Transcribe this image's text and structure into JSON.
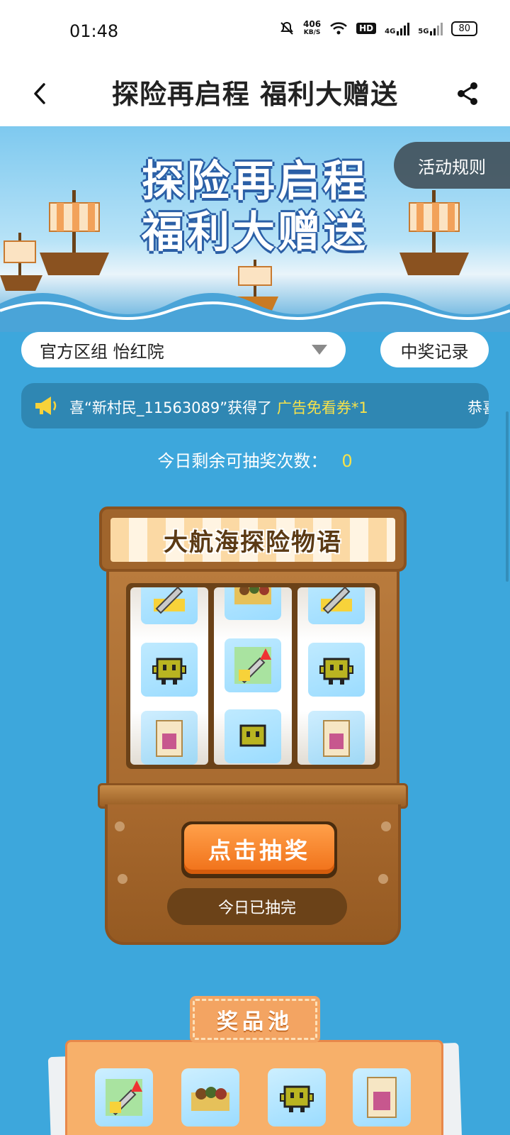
{
  "status_bar": {
    "time": "01:48",
    "net_speed_value": "406",
    "net_speed_unit": "KB/S",
    "hd_label": "HD",
    "net_4g": "4G",
    "net_5g": "5G",
    "battery": "80"
  },
  "nav": {
    "title": "探险再启程 福利大赠送"
  },
  "banner": {
    "title_line1": "探险再启程",
    "title_line2": "福利大赠送",
    "rules_label": "活动规则"
  },
  "server": {
    "selected": "官方区组 怡红院"
  },
  "record_label": "中奖记录",
  "marquee": {
    "prefix": "喜“新村民_11563089”获得了",
    "prize": "广告免看券*1",
    "tail": "恭喜"
  },
  "remaining": {
    "label": "今日剩余可抽奖次数：",
    "count": "0"
  },
  "machine": {
    "name": "大航海探险物语",
    "draw_label": "点击抽奖",
    "done_label": "今日已抽完",
    "reels": [
      [
        "sword-upgrade-icon",
        "robot-icon",
        "book-icon"
      ],
      [
        "adventurers-icon",
        "sword-upgrade-icon",
        "robot-icon"
      ],
      [
        "sword-upgrade-icon",
        "robot-icon",
        "book-icon"
      ]
    ]
  },
  "prize_pool": {
    "title": "奖品池",
    "items": [
      "sword-upgrade-icon",
      "adventurers-icon",
      "robot-icon",
      "book-icon"
    ]
  },
  "colors": {
    "background": "#3da7dc",
    "accent_yellow": "#f7e24a",
    "draw_button": "#f07018",
    "machine_wood": "#a86b30"
  }
}
